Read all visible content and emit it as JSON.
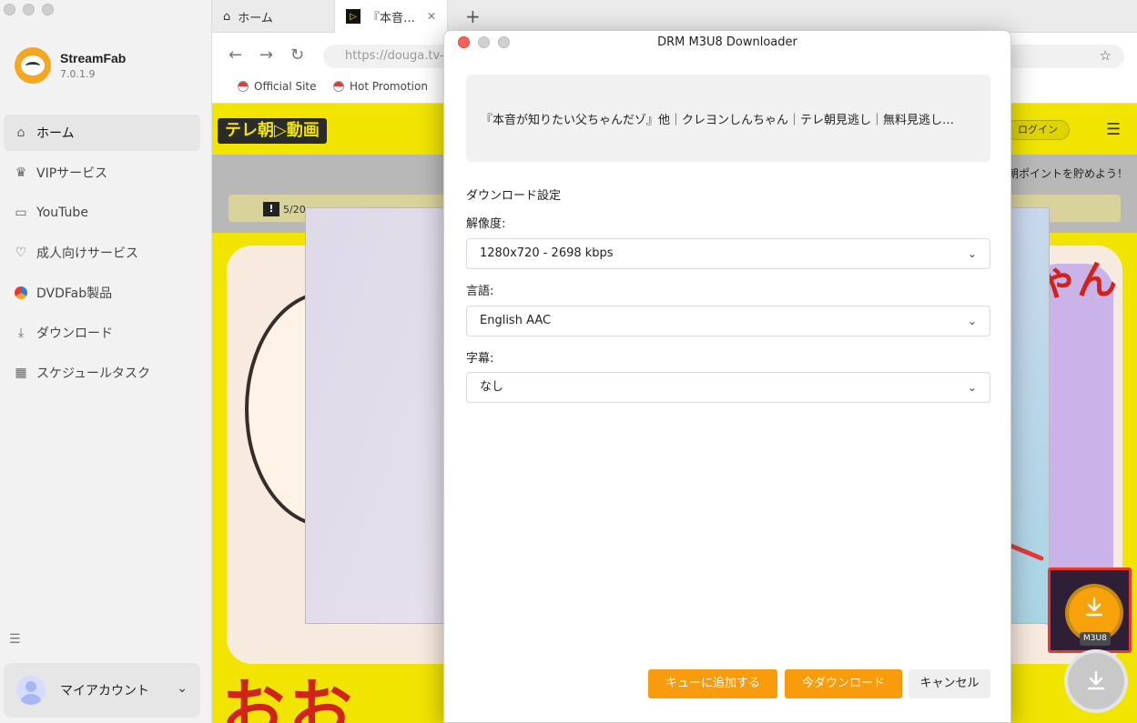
{
  "app": {
    "name": "StreamFab",
    "version": "7.0.1.9"
  },
  "sidebar": {
    "items": [
      {
        "label": "ホーム",
        "icon": "home-icon"
      },
      {
        "label": "VIPサービス",
        "icon": "crown-icon"
      },
      {
        "label": "YouTube",
        "icon": "youtube-icon"
      },
      {
        "label": "成人向けサービス",
        "icon": "heart-icon"
      },
      {
        "label": "DVDFab製品",
        "icon": "dvdfab-icon"
      },
      {
        "label": "ダウンロード",
        "icon": "download-icon"
      },
      {
        "label": "スケジュールタスク",
        "icon": "calendar-icon"
      }
    ],
    "account_label": "マイアカウント"
  },
  "browser": {
    "tabs": [
      {
        "label": "ホーム"
      },
      {
        "label": "『本音…"
      }
    ],
    "url": "https://douga.tv-a",
    "bookmarks": [
      "Official Site",
      "Hot Promotion"
    ]
  },
  "web": {
    "logo": "テレ朝▷動画",
    "login": "ログイン",
    "point_text": "朝ポイントを貯めよう！",
    "notice": "5/20",
    "art_text": "ちゃん",
    "bottom_text": "おお"
  },
  "modal": {
    "title": "DRM M3U8 Downloader",
    "video_title": "『本音が知りたい父ちゃんだゾ』他｜クレヨンしんちゃん｜テレ朝見逃し｜無料見逃し…",
    "section_heading": "ダウンロード設定",
    "resolution_label": "解像度:",
    "resolution_value": "1280x720 - 2698 kbps",
    "language_label": "言語:",
    "language_value": "English AAC",
    "subtitle_label": "字幕:",
    "subtitle_value": "なし",
    "buttons": {
      "add_to_queue": "キューに追加する",
      "download_now": "今ダウンロード",
      "cancel": "キャンセル"
    }
  },
  "floating": {
    "m3u8_label": "M3U8"
  },
  "colors": {
    "accent": "#f89b0c",
    "highlight_border": "#e53935",
    "web_yellow": "#f1e400"
  }
}
